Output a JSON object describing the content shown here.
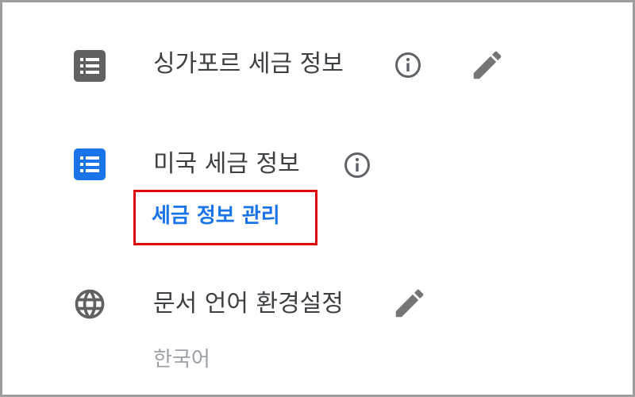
{
  "rows": {
    "singapore": {
      "title": "싱가포르 세금 정보",
      "icon": "list-box-icon",
      "icon_color": "#616161",
      "info_icon": "info-icon",
      "edit_icon": "pencil-icon"
    },
    "us": {
      "title": "미국 세금 정보",
      "icon": "list-box-icon",
      "icon_color": "#1a73e8",
      "info_icon": "info-icon",
      "link": "세금 정보 관리",
      "link_color": "#1a73e8",
      "highlight_color": "#e0000c"
    },
    "language": {
      "title": "문서 언어 환경설정",
      "icon": "globe-icon",
      "edit_icon": "pencil-icon",
      "value": "한국어"
    }
  }
}
